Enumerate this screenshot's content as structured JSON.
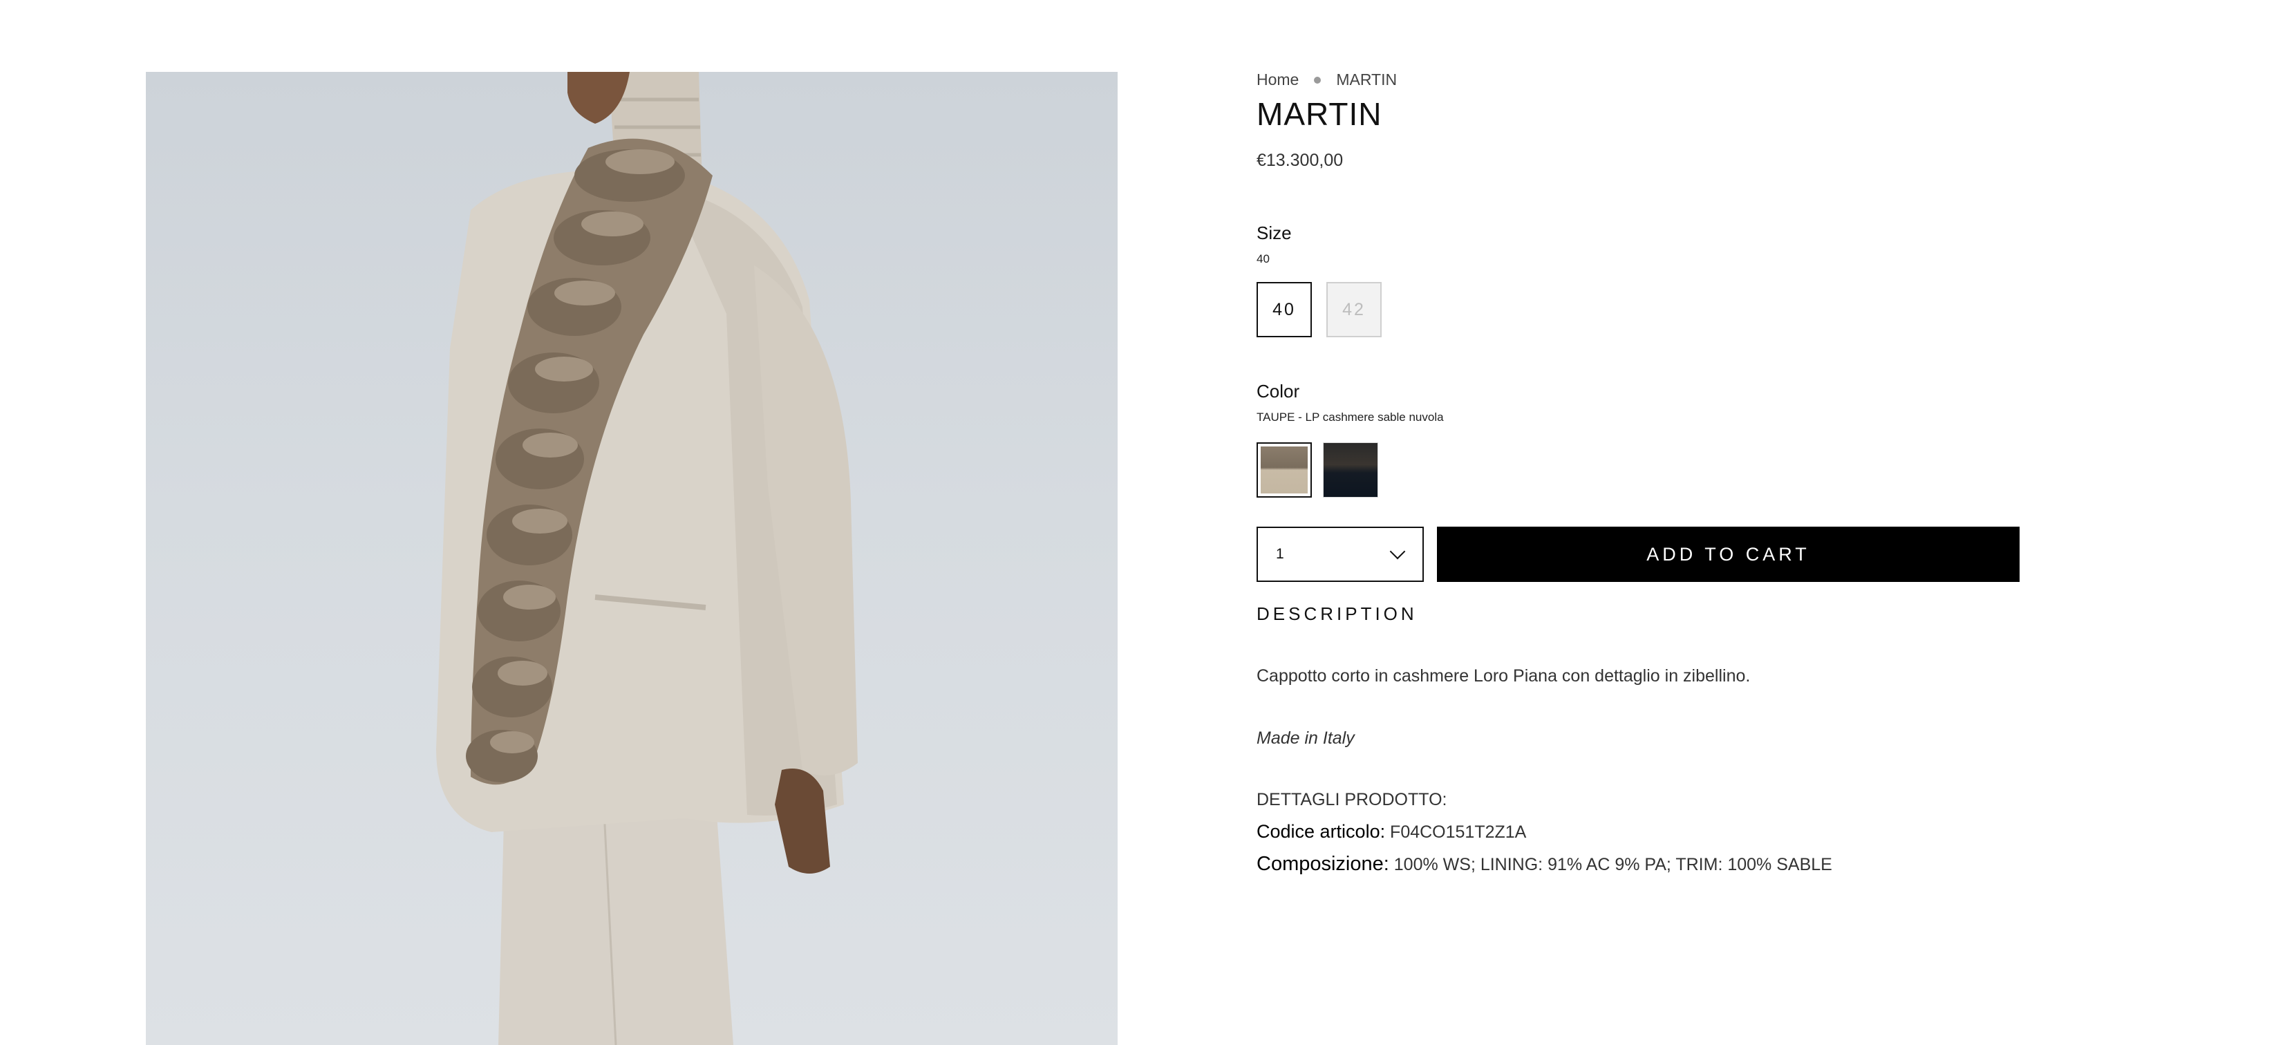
{
  "product": {
    "image_alt": "Model wearing taupe cashmere coat with sable fur trim"
  },
  "breadcrumb": {
    "home": "Home",
    "current": "MARTIN"
  },
  "title": "MARTIN",
  "price": "€13.300,00",
  "size": {
    "label": "Size",
    "selected": "40",
    "options": [
      "40",
      "42"
    ]
  },
  "color": {
    "label": "Color",
    "selected": "TAUPE - LP cashmere sable nuvola",
    "swatches": [
      "taupe",
      "dark"
    ],
    "swatch_colors": {
      "taupe": "#b9ab95",
      "dark": "#121a24"
    }
  },
  "quantity": {
    "value": "1"
  },
  "add_to_cart": "ADD TO CART",
  "description": {
    "heading": "DESCRIPTION",
    "text": "Cappotto corto in cashmere Loro Piana con dettaglio in zibellino.",
    "made_in": "Made in Italy",
    "details_heading": "DETTAGLI PRODOTTO:",
    "code_label": "Codice articolo:",
    "code_value": "F04CO151T2Z1A",
    "composition_label": "Composizione:",
    "composition_value": "100% WS; LINING: 91% AC 9% PA; TRIM: 100% SABLE"
  },
  "colors": {
    "accent": "#000000",
    "disabled_bg": "#f2f2f2",
    "disabled_text": "#bdbdbd"
  }
}
